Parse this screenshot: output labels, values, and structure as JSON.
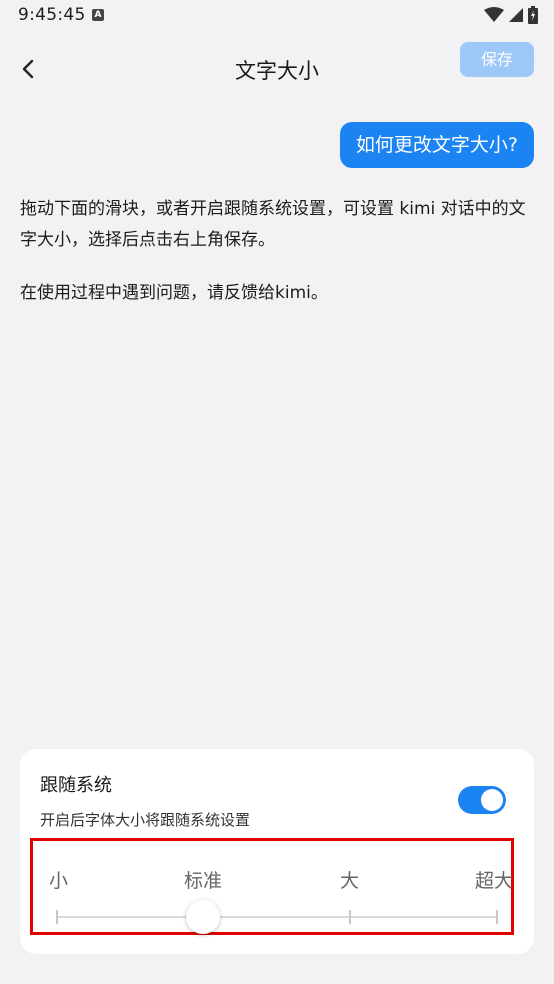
{
  "status_bar": {
    "time": "9:45:45",
    "notification_letter": "A"
  },
  "header": {
    "title": "文字大小",
    "save_label": "保存"
  },
  "chat": {
    "user_message": "如何更改文字大小?",
    "reply_paragraphs": [
      "拖动下面的滑块，或者开启跟随系统设置，可设置 kimi 对话中的文字大小，选择后点击右上角保存。",
      "在使用过程中遇到问题，请反馈给kimi。"
    ]
  },
  "settings": {
    "follow_system_title": "跟随系统",
    "follow_system_desc": "开启后字体大小将跟随系统设置",
    "follow_system_enabled": true
  },
  "slider": {
    "labels": [
      "小",
      "标准",
      "大",
      "超大"
    ],
    "selected_index": 1
  },
  "colors": {
    "accent": "#1b84f2",
    "save_disabled": "#9ec8f7",
    "highlight_box": "#e00000"
  }
}
